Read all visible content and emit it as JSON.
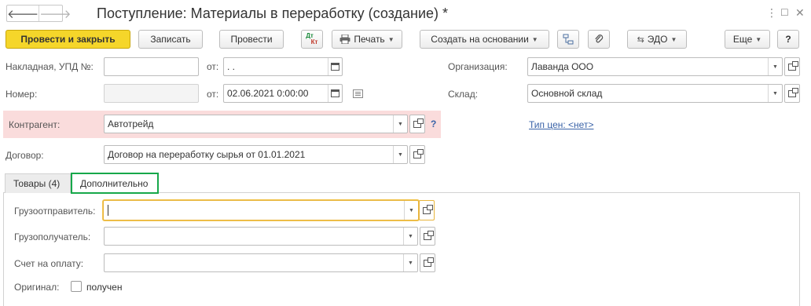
{
  "window": {
    "title": "Поступление: Материалы в переработку (создание) *",
    "back_glyph": "🡐",
    "forward_glyph": "🡒",
    "more_glyph": "⋮",
    "max_glyph": "☐",
    "close_glyph": "✕"
  },
  "toolbar": {
    "post_close": "Провести и закрыть",
    "save": "Записать",
    "post": "Провести",
    "dtkt_top": "Дт",
    "dtkt_bottom": "Кт",
    "print": "Печать",
    "create_based": "Создать на основании",
    "edo": "ЭДО",
    "more": "Еще",
    "help": "?"
  },
  "header_fields": {
    "invoice_label": "Накладная, УПД №:",
    "invoice_value": "",
    "invoice_from_label": "от:",
    "invoice_date": "  .  .",
    "number_label": "Номер:",
    "number_value": "",
    "number_from_label": "от:",
    "number_date": "02.06.2021  0:00:00",
    "org_label": "Организация:",
    "org_value": "Лаванда ООО",
    "warehouse_label": "Склад:",
    "warehouse_value": "Основной склад",
    "contractor_label": "Контрагент:",
    "contractor_value": "Автотрейд",
    "contractor_help": "?",
    "price_type_link": "Тип цен: <нет>",
    "contract_label": "Договор:",
    "contract_value": "Договор на переработку сырья от 01.01.2021"
  },
  "tabs": [
    {
      "label": "Товары (4)",
      "active": false
    },
    {
      "label": "Дополнительно",
      "active": true
    }
  ],
  "additional": {
    "shipper_label": "Грузоотправитель:",
    "shipper_value": "",
    "consignee_label": "Грузополучатель:",
    "consignee_value": "",
    "invoice_payment_label": "Счет на оплату:",
    "invoice_payment_value": "",
    "original_label": "Оригинал:",
    "original_checkbox_label": "получен",
    "original_received": false
  },
  "colors": {
    "primary_button": "#f5d62a",
    "required_highlight": "#fadcdc",
    "active_tab_border": "#17a84a",
    "focus_border": "#e8b53c",
    "link": "#3a63a8"
  }
}
